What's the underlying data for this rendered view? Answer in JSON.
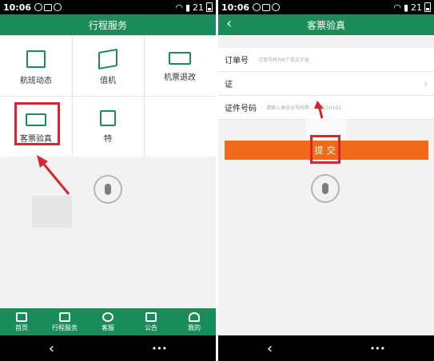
{
  "left_screen": {
    "status": {
      "time": "10:06",
      "signal": "21"
    },
    "title": "行程服务",
    "grid": [
      {
        "label": "航班动态",
        "icon": "flight-status-icon"
      },
      {
        "label": "值机",
        "icon": "checkin-icon"
      },
      {
        "label": "机票退改",
        "icon": "ticket-change-icon"
      },
      {
        "label": "客票验真",
        "icon": "ticket-verify-icon"
      },
      {
        "label": "特",
        "icon": "box-icon"
      }
    ],
    "tabs": [
      {
        "label": "首页",
        "icon": "home-icon"
      },
      {
        "label": "行程服务",
        "icon": "luggage-icon"
      },
      {
        "label": "客服",
        "icon": "phone-icon"
      },
      {
        "label": "公告",
        "icon": "message-icon"
      },
      {
        "label": "我的",
        "icon": "user-icon"
      }
    ],
    "nav": {
      "back": "‹",
      "more": "•••"
    }
  },
  "right_screen": {
    "status": {
      "time": "10:06",
      "signal": "21"
    },
    "title": "客票验真",
    "back": "‹",
    "rows": [
      {
        "label": "订单号",
        "placeholder": "订单号码为6个英文字母"
      },
      {
        "label": "证",
        "placeholder": ""
      },
      {
        "label": "证件号码",
        "placeholder": "请输入身份证号码等 ... 00150101"
      }
    ],
    "submit_label": "提交",
    "nav": {
      "back": "‹",
      "more": "•••"
    }
  },
  "colors": {
    "brand": "#1a8c5a",
    "accent": "#f26a18",
    "highlight": "#d42731"
  }
}
